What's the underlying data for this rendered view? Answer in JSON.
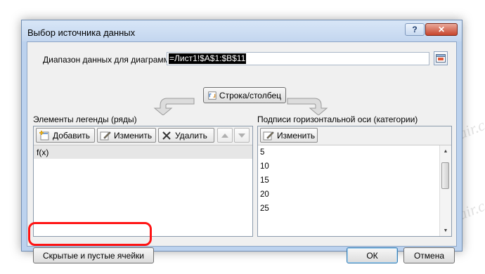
{
  "dialog": {
    "title": "Выбор источника данных",
    "help_label": "?",
    "close_label": "✕"
  },
  "range": {
    "label": "Диапазон данных для диаграммы:",
    "value": "=Лист1!$A$1:$B$11"
  },
  "switch_button": {
    "label": "Строка/столбец"
  },
  "legend": {
    "label": "Элементы легенды (ряды)",
    "add_label": "Добавить",
    "edit_label": "Изменить",
    "delete_label": "Удалить",
    "series": [
      "f(x)"
    ]
  },
  "axis": {
    "label": "Подписи горизонтальной оси (категории)",
    "edit_label": "Изменить",
    "categories": [
      "5",
      "10",
      "15",
      "20",
      "25"
    ]
  },
  "footer": {
    "hidden_cells_label": "Скрытые и пустые ячейки",
    "ok_label": "ОК",
    "cancel_label": "Отмена"
  },
  "watermark": {
    "text": "Sovinaprepair.com"
  },
  "colors": {
    "highlight": "#ff1414",
    "selection": "#000000",
    "series_row": "#e6e6e6"
  }
}
